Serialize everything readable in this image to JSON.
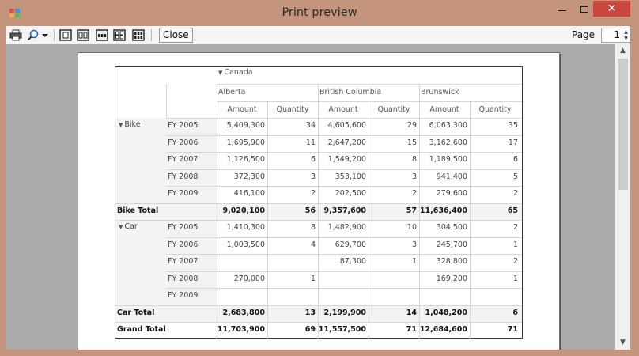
{
  "window": {
    "title": "Print preview"
  },
  "toolbar": {
    "close_label": "Close",
    "page_label": "Page",
    "page_value": "1"
  },
  "pivot": {
    "country": "Canada",
    "regions": [
      "Alberta",
      "British Columbia",
      "Brunswick"
    ],
    "measures": [
      "Amount",
      "Quantity"
    ],
    "groups": [
      {
        "name": "Bike",
        "rows": [
          {
            "year": "FY 2005",
            "values": [
              "5,409,300",
              "34",
              "4,605,600",
              "29",
              "6,063,300",
              "35"
            ]
          },
          {
            "year": "FY 2006",
            "values": [
              "1,695,900",
              "11",
              "2,647,200",
              "15",
              "3,162,600",
              "17"
            ]
          },
          {
            "year": "FY 2007",
            "values": [
              "1,126,500",
              "6",
              "1,549,200",
              "8",
              "1,189,500",
              "6"
            ]
          },
          {
            "year": "FY 2008",
            "values": [
              "372,300",
              "3",
              "353,100",
              "3",
              "941,400",
              "5"
            ]
          },
          {
            "year": "FY 2009",
            "values": [
              "416,100",
              "2",
              "202,500",
              "2",
              "279,600",
              "2"
            ]
          }
        ],
        "total_label": "Bike Total",
        "total": [
          "9,020,100",
          "56",
          "9,357,600",
          "57",
          "11,636,400",
          "65"
        ]
      },
      {
        "name": "Car",
        "rows": [
          {
            "year": "FY 2005",
            "values": [
              "1,410,300",
              "8",
              "1,482,900",
              "10",
              "304,500",
              "2"
            ]
          },
          {
            "year": "FY 2006",
            "values": [
              "1,003,500",
              "4",
              "629,700",
              "3",
              "245,700",
              "1"
            ]
          },
          {
            "year": "FY 2007",
            "values": [
              "",
              "",
              "87,300",
              "1",
              "328,800",
              "2"
            ]
          },
          {
            "year": "FY 2008",
            "values": [
              "270,000",
              "1",
              "",
              "",
              "169,200",
              "1"
            ]
          },
          {
            "year": "FY 2009",
            "values": [
              "",
              "",
              "",
              "",
              "",
              ""
            ]
          }
        ],
        "total_label": "Car Total",
        "total": [
          "2,683,800",
          "13",
          "2,199,900",
          "14",
          "1,048,200",
          "6"
        ]
      }
    ],
    "grand_total_label": "Grand Total",
    "grand_total": [
      "11,703,900",
      "69",
      "11,557,500",
      "71",
      "12,684,600",
      "71"
    ]
  },
  "icons": {
    "print": "printer-icon",
    "zoom": "magnifier-icon",
    "zoom_dropdown": "chevron-down-icon",
    "one_page": "one-page-icon",
    "two_pages": "two-pages-icon",
    "three_pages": "three-pages-icon",
    "four_pages": "four-pages-icon",
    "six_pages": "six-pages-icon"
  }
}
